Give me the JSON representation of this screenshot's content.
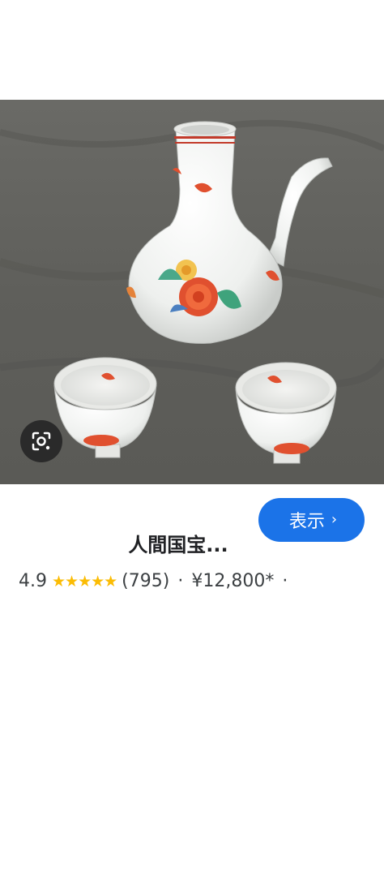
{
  "product": {
    "title": "人間国宝...",
    "rating": "4.9",
    "stars": "★★★★★",
    "review_count": "(795)",
    "separator": "·",
    "price": "¥12,800*",
    "trailing_separator": "·"
  },
  "actions": {
    "show_label": "表示",
    "show_chevron": "›"
  },
  "icons": {
    "lens": "google-lens-icon",
    "chevron": "chevron-right-icon"
  },
  "colors": {
    "accent": "#1b73e8",
    "star": "#fbbc04",
    "text": "#202124"
  }
}
